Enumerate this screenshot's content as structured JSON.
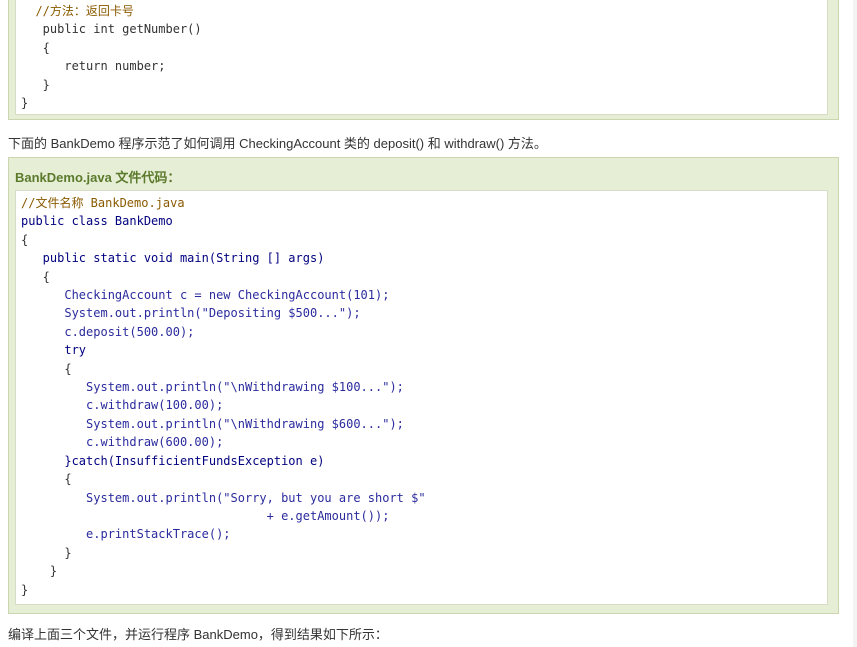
{
  "code_block_1": {
    "lines": [
      "  //方法：返回卡号",
      "   public int getNumber()",
      "   {",
      "      return number;",
      "   }",
      "}"
    ]
  },
  "paragraph_1": "下面的 BankDemo 程序示范了如何调用 CheckingAccount 类的 deposit() 和 withdraw() 方法。",
  "code_block_2": {
    "title": "BankDemo.java 文件代码：",
    "lines": [
      "//文件名称 BankDemo.java",
      "public class BankDemo",
      "{",
      "   public static void main(String [] args)",
      "   {",
      "      CheckingAccount c = new CheckingAccount(101);",
      "      System.out.println(\"Depositing $500...\");",
      "      c.deposit(500.00);",
      "      try",
      "      {",
      "         System.out.println(\"\\nWithdrawing $100...\");",
      "         c.withdraw(100.00);",
      "         System.out.println(\"\\nWithdrawing $600...\");",
      "         c.withdraw(600.00);",
      "      }catch(InsufficientFundsException e)",
      "      {",
      "         System.out.println(\"Sorry, but you are short $\"",
      "                                  + e.getAmount());",
      "         e.printStackTrace();",
      "      }",
      "    }",
      "}"
    ]
  },
  "paragraph_2": "编译上面三个文件，并运行程序 BankDemo，得到结果如下所示："
}
